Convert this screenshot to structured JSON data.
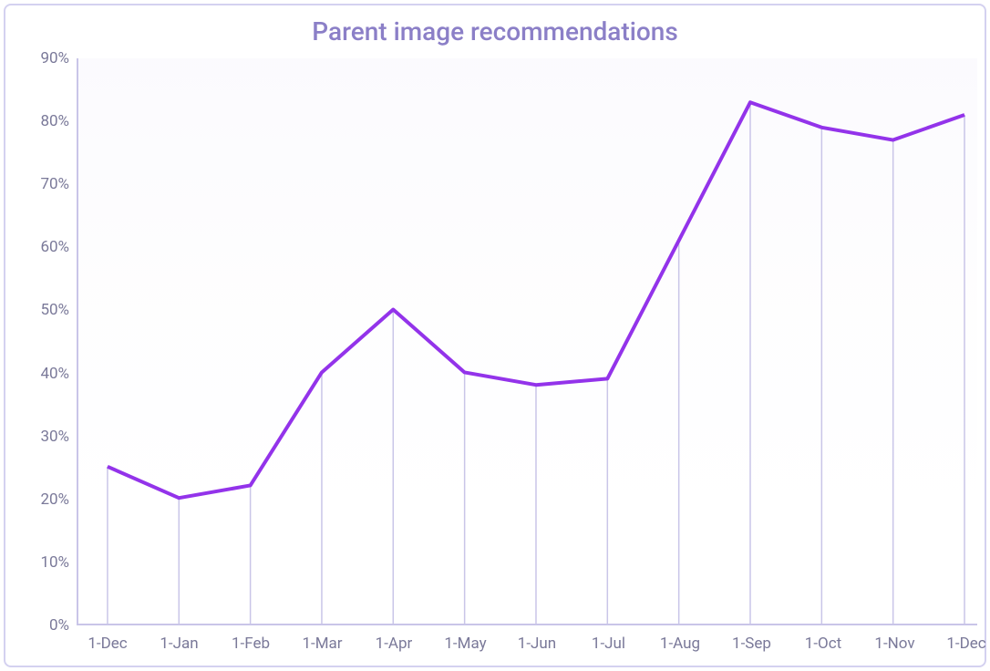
{
  "chart_data": {
    "type": "line",
    "title": "Parent image recommendations",
    "categories": [
      "1-Dec",
      "1-Jan",
      "1-Feb",
      "1-Mar",
      "1-Apr",
      "1-May",
      "1-Jun",
      "1-Jul",
      "1-Aug",
      "1-Sep",
      "1-Oct",
      "1-Nov",
      "1-Dec"
    ],
    "values": [
      25,
      20,
      22,
      40,
      50,
      40,
      38,
      39,
      61,
      83,
      79,
      77,
      81
    ],
    "xlabel": "",
    "ylabel": "",
    "ylim": [
      0,
      90
    ],
    "y_ticks": [
      0,
      10,
      20,
      30,
      40,
      50,
      60,
      70,
      80,
      90
    ],
    "y_tick_labels": [
      "0%",
      "10%",
      "20%",
      "30%",
      "40%",
      "50%",
      "60%",
      "70%",
      "80%",
      "90%"
    ],
    "colors": {
      "line": "#9333ea",
      "axis": "#c9c5e8",
      "text": "#7a7999",
      "title": "#8b7fc7",
      "border": "#d4d1f0"
    }
  }
}
